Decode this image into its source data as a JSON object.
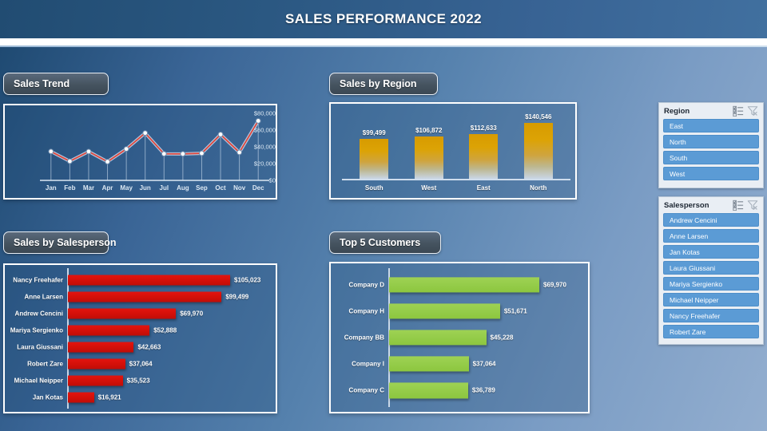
{
  "header": {
    "title": "SALES PERFORMANCE 2022"
  },
  "cards": {
    "sales_trend": "Sales Trend",
    "sales_by_region": "Sales by Region",
    "sales_by_salesperson": "Sales by Salesperson",
    "top5_customers": "Top 5 Customers"
  },
  "slicers": [
    {
      "title": "Region",
      "multiselect_icon": "multi-select-icon",
      "clear_filter_icon": "clear-filter-icon",
      "items": [
        "East",
        "North",
        "South",
        "West"
      ]
    },
    {
      "title": "Salesperson",
      "multiselect_icon": "multi-select-icon",
      "clear_filter_icon": "clear-filter-icon",
      "items": [
        "Andrew Cencini",
        "Anne Larsen",
        "Jan Kotas",
        "Laura Giussani",
        "Mariya Sergienko",
        "Michael Neipper",
        "Nancy Freehafer",
        "Robert Zare"
      ]
    }
  ],
  "chart_data": [
    {
      "type": "line",
      "title": "Sales Trend",
      "xlabel": "",
      "ylabel": "",
      "ylim": [
        0,
        80000
      ],
      "yticks": [
        0,
        20000,
        40000,
        60000,
        80000
      ],
      "ytick_labels": [
        "$0",
        "$20,000",
        "$40,000",
        "$60,000",
        "$80,000"
      ],
      "grid": false,
      "categories": [
        "Jan",
        "Feb",
        "Mar",
        "Apr",
        "May",
        "Jun",
        "Jul",
        "Aug",
        "Sep",
        "Oct",
        "Nov",
        "Dec"
      ],
      "values": [
        34500,
        22800,
        34400,
        22300,
        37500,
        56500,
        31700,
        31600,
        32300,
        54800,
        33400,
        71000
      ],
      "line_color": "#e0473c",
      "marker_color": "#ffffff"
    },
    {
      "type": "bar",
      "title": "Sales by Region",
      "xlabel": "",
      "ylabel": "",
      "categories": [
        "South",
        "West",
        "East",
        "North"
      ],
      "values": [
        99499,
        106872,
        112633,
        140546
      ],
      "value_labels": [
        "$99,499",
        "$106,872",
        "$112,633",
        "$140,546"
      ],
      "ylim": [
        0,
        160000
      ],
      "grid": false,
      "bar_color": "#d79b00"
    },
    {
      "type": "bar",
      "orientation": "horizontal",
      "title": "Sales by Salesperson",
      "xlabel": "",
      "ylabel": "",
      "categories": [
        "Nancy Freehafer",
        "Anne Larsen",
        "Andrew Cencini",
        "Mariya Sergienko",
        "Laura Giussani",
        "Robert Zare",
        "Michael Neipper",
        "Jan Kotas"
      ],
      "values": [
        105023,
        99499,
        69970,
        52888,
        42663,
        37064,
        35523,
        16921
      ],
      "value_labels": [
        "$105,023",
        "$99,499",
        "$69,970",
        "$52,888",
        "$42,663",
        "$37,064",
        "$35,523",
        "$16,921"
      ],
      "xlim": [
        0,
        105023
      ],
      "grid": false,
      "bar_color": "#d41009"
    },
    {
      "type": "bar",
      "orientation": "horizontal",
      "title": "Top 5 Customers",
      "xlabel": "",
      "ylabel": "",
      "categories": [
        "Company D",
        "Company H",
        "Company BB",
        "Company I",
        "Company C"
      ],
      "values": [
        69970,
        51671,
        45228,
        37064,
        36789
      ],
      "value_labels": [
        "$69,970",
        "$51,671",
        "$45,228",
        "$37,064",
        "$36,789"
      ],
      "xlim": [
        0,
        69970
      ],
      "grid": false,
      "bar_color": "#8cc63f"
    }
  ]
}
